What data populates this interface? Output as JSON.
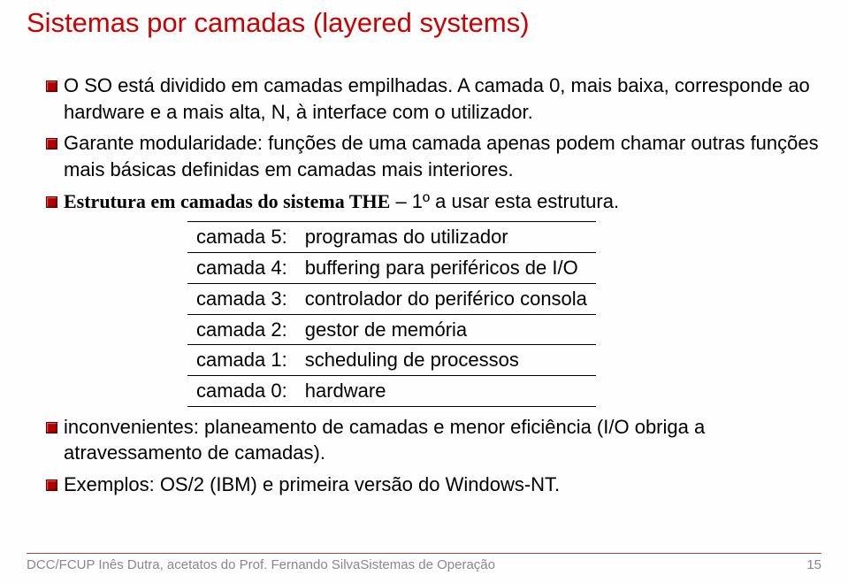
{
  "title": "Sistemas por camadas (layered systems)",
  "bullets": {
    "b1": "O SO está dividido em camadas empilhadas. A camada 0, mais baixa, corresponde ao hardware e a mais alta, N, à interface com o utilizador.",
    "b2": "Garante modularidade: funções de uma camada apenas podem chamar outras funções mais básicas definidas em camadas mais interiores.",
    "b3_prefix": "Estrutura em camadas do sistema THE",
    "b3_rest": " – 1º a usar esta estrutura.",
    "b4": "inconvenientes: planeamento de camadas e menor eficiência (I/O obriga a atravessamento de camadas).",
    "b5": "Exemplos: OS/2 (IBM) e primeira versão do Windows-NT."
  },
  "table": {
    "r5l": "camada 5:",
    "r5r": "programas do utilizador",
    "r4l": "camada 4:",
    "r4r": "buffering para periféricos de I/O",
    "r3l": "camada 3:",
    "r3r": "controlador do periférico consola",
    "r2l": "camada 2:",
    "r2r": "gestor de memória",
    "r1l": "camada 1:",
    "r1r": "scheduling de processos",
    "r0l": "camada 0:",
    "r0r": "hardware"
  },
  "footer": {
    "left": "DCC/FCUP Inês Dutra, acetatos do Prof. Fernando SilvaSistemas de Operação",
    "right": "15"
  }
}
